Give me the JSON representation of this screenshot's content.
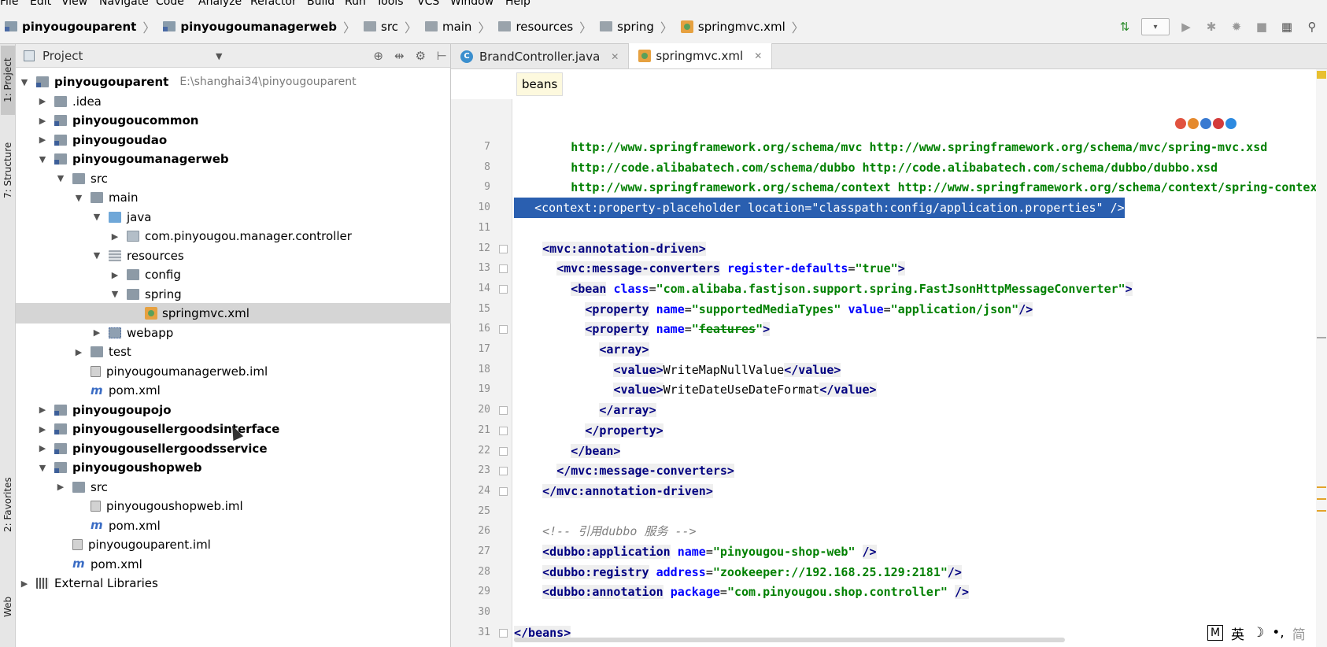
{
  "menu": [
    "File",
    "Edit",
    "View",
    "Navigate",
    "Code",
    "Analyze",
    "Refactor",
    "Build",
    "Run",
    "Tools",
    "VCS",
    "Window",
    "Help"
  ],
  "breadcrumb": [
    {
      "label": "pinyougouparent",
      "icon": "module-folder-icon",
      "bold": true
    },
    {
      "label": "pinyougoumanagerweb",
      "icon": "module-folder-icon",
      "bold": true
    },
    {
      "label": "src",
      "icon": "folder-icon",
      "bold": false
    },
    {
      "label": "main",
      "icon": "folder-icon",
      "bold": false
    },
    {
      "label": "resources",
      "icon": "resources-folder-icon",
      "bold": false
    },
    {
      "label": "spring",
      "icon": "folder-icon",
      "bold": false
    },
    {
      "label": "springmvc.xml",
      "icon": "xml-file-icon",
      "bold": false
    }
  ],
  "left_strip": {
    "project": "1: Project",
    "structure": "7: Structure",
    "favorites": "2: Favorites",
    "web": "Web"
  },
  "project_panel": {
    "title": "Project",
    "root_path": "E:\\shanghai34\\pinyougouparent",
    "nodes": [
      {
        "label": "pinyougouparent",
        "depth": 0,
        "arrow": "down",
        "icon": "mod",
        "bold": true
      },
      {
        "label": ".idea",
        "depth": 1,
        "arrow": "right",
        "icon": "folder",
        "bold": false
      },
      {
        "label": "pinyougoucommon",
        "depth": 1,
        "arrow": "right",
        "icon": "mod",
        "bold": true
      },
      {
        "label": "pinyougoudao",
        "depth": 1,
        "arrow": "right",
        "icon": "mod",
        "bold": true
      },
      {
        "label": "pinyougoumanagerweb",
        "depth": 1,
        "arrow": "down",
        "icon": "mod",
        "bold": true
      },
      {
        "label": "src",
        "depth": 2,
        "arrow": "down",
        "icon": "folder",
        "bold": false
      },
      {
        "label": "main",
        "depth": 3,
        "arrow": "down",
        "icon": "folder",
        "bold": false
      },
      {
        "label": "java",
        "depth": 4,
        "arrow": "down",
        "icon": "java",
        "bold": false
      },
      {
        "label": "com.pinyougou.manager.controller",
        "depth": 5,
        "arrow": "right",
        "icon": "pkg",
        "bold": false
      },
      {
        "label": "resources",
        "depth": 4,
        "arrow": "down",
        "icon": "res",
        "bold": false
      },
      {
        "label": "config",
        "depth": 5,
        "arrow": "right",
        "icon": "folder",
        "bold": false
      },
      {
        "label": "spring",
        "depth": 5,
        "arrow": "down",
        "icon": "folder",
        "bold": false
      },
      {
        "label": "springmvc.xml",
        "depth": 6,
        "arrow": "",
        "icon": "xml",
        "bold": false,
        "selected": true
      },
      {
        "label": "webapp",
        "depth": 4,
        "arrow": "right",
        "icon": "web",
        "bold": false
      },
      {
        "label": "test",
        "depth": 3,
        "arrow": "right",
        "icon": "folder",
        "bold": false
      },
      {
        "label": "pinyougoumanagerweb.iml",
        "depth": 3,
        "arrow": "",
        "icon": "iml",
        "bold": false
      },
      {
        "label": "pom.xml",
        "depth": 3,
        "arrow": "",
        "icon": "pom",
        "bold": false
      },
      {
        "label": "pinyougoupojo",
        "depth": 1,
        "arrow": "right",
        "icon": "mod",
        "bold": true
      },
      {
        "label": "pinyougousellergoodsinterface",
        "depth": 1,
        "arrow": "right",
        "icon": "mod",
        "bold": true
      },
      {
        "label": "pinyougousellergoodsservice",
        "depth": 1,
        "arrow": "right",
        "icon": "mod",
        "bold": true
      },
      {
        "label": "pinyougoushopweb",
        "depth": 1,
        "arrow": "down",
        "icon": "mod",
        "bold": true
      },
      {
        "label": "src",
        "depth": 2,
        "arrow": "right",
        "icon": "folder",
        "bold": false
      },
      {
        "label": "pinyougoushopweb.iml",
        "depth": 3,
        "arrow": "",
        "icon": "iml",
        "bold": false
      },
      {
        "label": "pom.xml",
        "depth": 3,
        "arrow": "",
        "icon": "pom",
        "bold": false
      },
      {
        "label": "pinyougouparent.iml",
        "depth": 2,
        "arrow": "",
        "icon": "iml",
        "bold": false
      },
      {
        "label": "pom.xml",
        "depth": 2,
        "arrow": "",
        "icon": "pom",
        "bold": false
      },
      {
        "label": "External Libraries",
        "depth": 0,
        "arrow": "right",
        "icon": "libs",
        "bold": false
      }
    ]
  },
  "editor": {
    "tabs": [
      {
        "label": "BrandController.java",
        "icon": "java-class-icon",
        "active": false
      },
      {
        "label": "springmvc.xml",
        "icon": "xml-file-icon",
        "active": true
      }
    ],
    "breadcrumb_popup": "beans",
    "lines": [
      {
        "n": "7",
        "html": "        <span class=\"url\">http://www.springframework.org/schema/mvc http://www.springframework.org/schema/mvc/spring-mvc.xsd</span>"
      },
      {
        "n": "8",
        "html": "        <span class=\"url\">http://code.alibabatech.com/schema/dubbo http://code.alibabatech.com/schema/dubbo/dubbo.xsd</span>"
      },
      {
        "n": "9",
        "html": "        <span class=\"url\">http://www.springframework.org/schema/context http://www.springframework.org/schema/context/spring-context.xsd</span>"
      },
      {
        "n": "10",
        "selected": true,
        "html": "    <span>&lt;context:property-placeholder location=\"classpath:config/application.properties\" /&gt;</span>"
      },
      {
        "n": "11",
        "html": ""
      },
      {
        "n": "12",
        "html": "    <span class=\"tg\">&lt;mvc:annotation-driven&gt;</span>"
      },
      {
        "n": "13",
        "html": "      <span class=\"tg\">&lt;mvc:message-converters</span> <span class=\"at\">register-defaults</span>=<span class=\"vl\">\"true\"</span><span class=\"tg\">&gt;</span>"
      },
      {
        "n": "14",
        "html": "        <span class=\"tg\">&lt;bean</span> <span class=\"at\">class</span>=<span class=\"vl\">\"com.alibaba.fastjson.support.spring.FastJsonHttpMessageConverter\"</span><span class=\"tg\">&gt;</span>"
      },
      {
        "n": "15",
        "html": "          <span class=\"tg\">&lt;property</span> <span class=\"at\">name</span>=<span class=\"vl\">\"supportedMediaTypes\"</span> <span class=\"at\">value</span>=<span class=\"vl\">\"application/json\"</span><span class=\"tg\">/&gt;</span>"
      },
      {
        "n": "16",
        "html": "          <span class=\"tg\">&lt;property</span> <span class=\"at\">name</span>=<span class=\"vl\">\"<span class=\"strike\">features</span>\"</span><span class=\"tg\">&gt;</span>"
      },
      {
        "n": "17",
        "html": "            <span class=\"tg\">&lt;array&gt;</span>"
      },
      {
        "n": "18",
        "html": "              <span class=\"tg\">&lt;value&gt;</span>WriteMapNullValue<span class=\"tg\">&lt;/value&gt;</span>"
      },
      {
        "n": "19",
        "html": "              <span class=\"tg\">&lt;value&gt;</span>WriteDateUseDateFormat<span class=\"tg\">&lt;/value&gt;</span>"
      },
      {
        "n": "20",
        "html": "            <span class=\"tg\">&lt;/array&gt;</span>"
      },
      {
        "n": "21",
        "html": "          <span class=\"tg\">&lt;/property&gt;</span>"
      },
      {
        "n": "22",
        "html": "        <span class=\"tg\">&lt;/bean&gt;</span>"
      },
      {
        "n": "23",
        "html": "      <span class=\"tg\">&lt;/mvc:message-converters&gt;</span>"
      },
      {
        "n": "24",
        "html": "    <span class=\"tg\">&lt;/mvc:annotation-driven&gt;</span>"
      },
      {
        "n": "25",
        "html": ""
      },
      {
        "n": "26",
        "html": "    <span class=\"cm\">&lt;!-- 引用dubbo 服务 --&gt;</span>"
      },
      {
        "n": "27",
        "html": "    <span class=\"tg\">&lt;dubbo:application</span> <span class=\"at\">name</span>=<span class=\"vl\">\"pinyougou-shop-web\"</span> <span class=\"tg\">/&gt;</span>"
      },
      {
        "n": "28",
        "html": "    <span class=\"tg\">&lt;dubbo:registry</span> <span class=\"at\">address</span>=<span class=\"vl\">\"zookeeper://192.168.25.129:2181\"</span><span class=\"tg\">/&gt;</span>"
      },
      {
        "n": "29",
        "html": "    <span class=\"tg\">&lt;dubbo:annotation</span> <span class=\"at\">package</span>=<span class=\"vl\">\"com.pinyougou.shop.controller\"</span> <span class=\"tg\">/&gt;</span>"
      },
      {
        "n": "30",
        "html": ""
      },
      {
        "n": "31",
        "html": "<span class=\"tg\">&lt;/beans&gt;</span>"
      }
    ]
  },
  "ime": {
    "mode": "M",
    "lang": "英",
    "sym1": "☽",
    "sym2": "•,",
    "sym3": "简"
  },
  "colors": {
    "selection": "#2a5fb0",
    "tag": "#000080",
    "attr": "#0000ff",
    "value": "#008000"
  }
}
